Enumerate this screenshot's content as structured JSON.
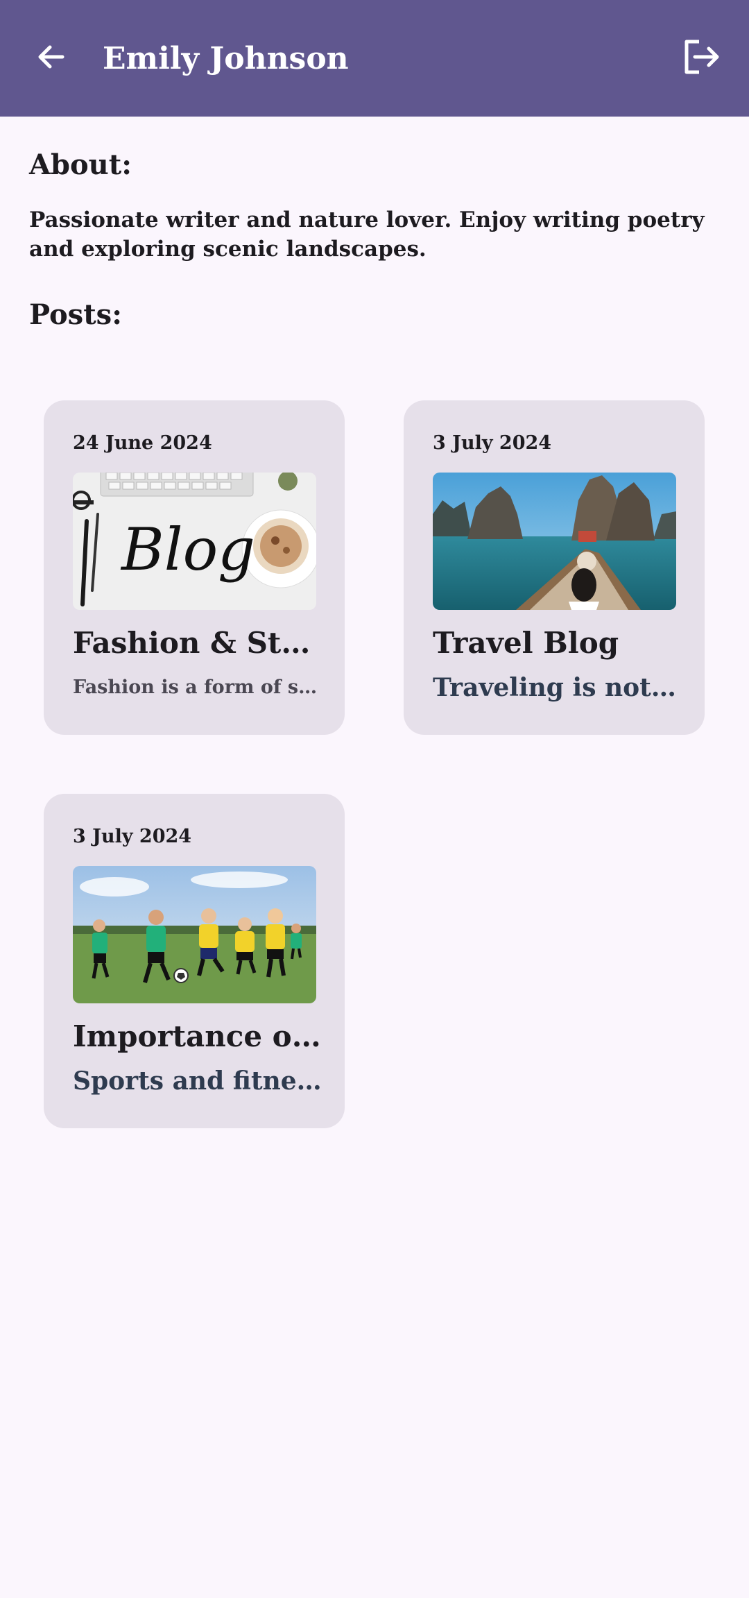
{
  "header": {
    "title": "Emily Johnson",
    "back_icon": "arrow-left-icon",
    "logout_icon": "logout-icon",
    "bar_color": "#60578f"
  },
  "about": {
    "heading": "About:",
    "text": "Passionate writer and nature lover. Enjoy writing poetry and exploring scenic landscapes."
  },
  "posts": {
    "heading": "Posts:",
    "items": [
      {
        "date": "24 June 2024",
        "title": "Fashion & Style…",
        "excerpt": "Fashion is a form of self-…",
        "image": "blog-desk-image"
      },
      {
        "date": "3 July 2024",
        "title": "Travel Blog",
        "excerpt": "Traveling is not jus…",
        "image": "boat-cliffs-image"
      },
      {
        "date": "3 July 2024",
        "title": "Importance of …",
        "excerpt": "Sports and fitness …",
        "image": "kids-soccer-image"
      }
    ]
  }
}
